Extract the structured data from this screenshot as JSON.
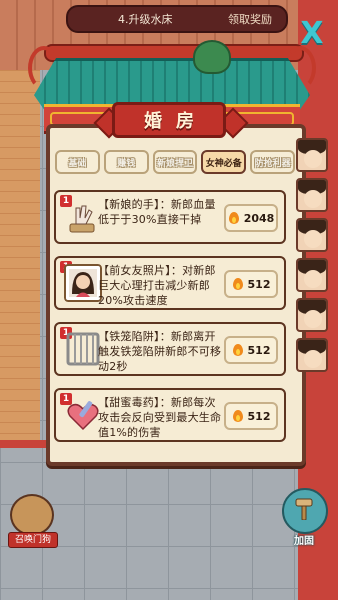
{
  "quest": {
    "text": "4.升级水床",
    "claim": "领取奖励"
  },
  "close_glyph": "X",
  "panel": {
    "title": "婚房",
    "tabs": [
      {
        "label": "基础",
        "active": false
      },
      {
        "label": "赚钱",
        "active": false
      },
      {
        "label": "新娘捍卫",
        "active": false
      },
      {
        "label": "女神必备",
        "active": true
      },
      {
        "label": "防抢利器",
        "active": false
      }
    ],
    "items": [
      {
        "level": "1",
        "desc": "【新娘的手】：新郎血量低于于30%直接干掉",
        "price": "2048",
        "icon": "hand-icon"
      },
      {
        "level": "1",
        "desc": "【前女友照片】：对新郎巨大心理打击减少新郎20%攻击速度",
        "price": "512",
        "icon": "photo-icon"
      },
      {
        "level": "1",
        "desc": "【铁笼陷阱】：新郎离开触发铁笼陷阱新郎不可移动2秒",
        "price": "512",
        "icon": "cage-icon"
      },
      {
        "level": "1",
        "desc": "【甜蜜毒药】：新郎每次攻击会反向受到最大生命值1%的伤害",
        "price": "512",
        "icon": "heart-potion-icon"
      }
    ]
  },
  "bottom": {
    "pet_label": "召唤门狗",
    "build_label": "加固"
  },
  "colors": {
    "roof_teal": "#2a9a8c",
    "sign_red": "#c0322a",
    "panel_bg": "#f4ead2"
  }
}
